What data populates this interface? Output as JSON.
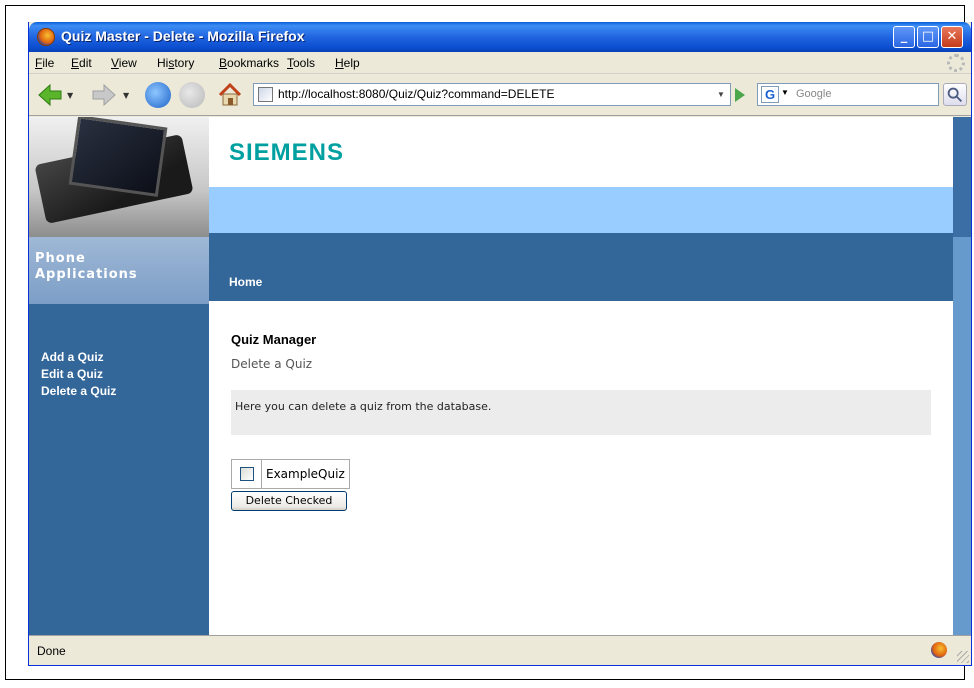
{
  "window": {
    "title": "Quiz Master - Delete - Mozilla Firefox",
    "controls": {
      "minimize": "_",
      "maximize": "□",
      "close": "✕"
    }
  },
  "menu": [
    {
      "label": "File",
      "mnemonic": "F",
      "rest": "ile"
    },
    {
      "label": "Edit",
      "mnemonic": "E",
      "rest": "dit"
    },
    {
      "label": "View",
      "mnemonic": "V",
      "rest": "iew"
    },
    {
      "label": "History",
      "mnemonic": "s",
      "pre": "Hi",
      "rest": "tory"
    },
    {
      "label": "Bookmarks",
      "mnemonic": "B",
      "rest": "ookmarks"
    },
    {
      "label": "Tools",
      "mnemonic": "T",
      "rest": "ools"
    },
    {
      "label": "Help",
      "mnemonic": "H",
      "rest": "elp"
    }
  ],
  "navbar": {
    "url": "http://localhost:8080/Quiz/Quiz?command=DELETE",
    "search_engine_letter": "G",
    "search_placeholder": "Google"
  },
  "site": {
    "brand_line1": "Phone",
    "brand_line2": "Applications",
    "logo": "SIEMENS",
    "home_link": "Home",
    "sidenav": [
      "Add a Quiz",
      "Edit a Quiz",
      "Delete a Quiz"
    ]
  },
  "main": {
    "title": "Quiz Manager",
    "subtitle": "Delete a Quiz",
    "info": "Here you can delete a quiz from the database.",
    "quizzes": [
      {
        "name": "ExampleQuiz",
        "checked": false
      }
    ],
    "delete_button": "Delete Checked"
  },
  "status": {
    "text": "Done"
  }
}
